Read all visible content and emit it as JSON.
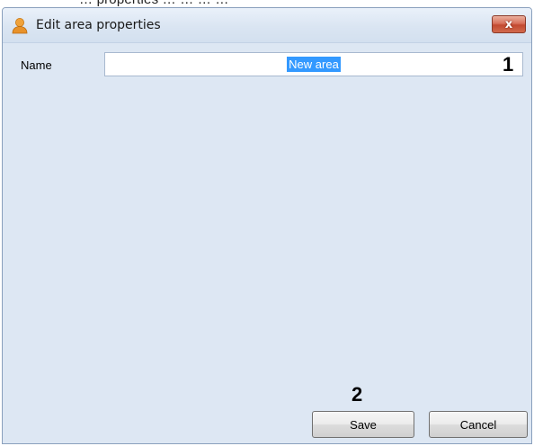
{
  "top_fragment": "… properties … … … …",
  "dialog": {
    "title": "Edit area properties",
    "close_label": "x",
    "icon": "user-icon"
  },
  "form": {
    "name_label": "Name",
    "name_value": "New area"
  },
  "callouts": {
    "one": "1",
    "two": "2"
  },
  "buttons": {
    "save_label": "Save",
    "cancel_label": "Cancel"
  },
  "colors": {
    "window_bg": "#dde7f3",
    "selection": "#3399ff",
    "close_button": "#c24a30"
  }
}
